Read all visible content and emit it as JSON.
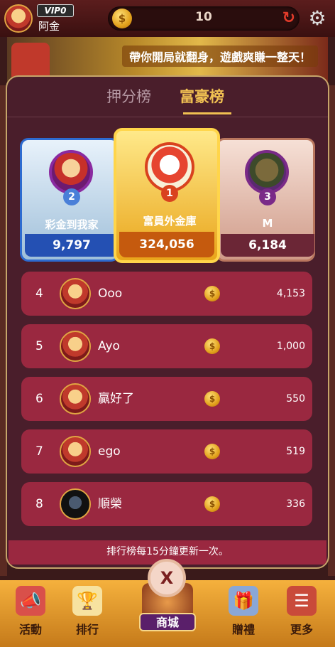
{
  "header": {
    "vip_label": "VIP0",
    "username": "阿金",
    "balance": "10",
    "coin_glyph": "$",
    "refresh_icon": "refresh-icon",
    "settings_icon": "gear-icon"
  },
  "banner": {
    "text": "帶你開局就翻身，遊戲爽賺一整天！"
  },
  "tabs": [
    {
      "label": "押分榜",
      "active": false
    },
    {
      "label": "富豪榜",
      "active": true
    }
  ],
  "podium": [
    {
      "rank": "2",
      "name": "彩金到我家",
      "value": "9,797"
    },
    {
      "rank": "1",
      "name": "富員外金庫",
      "value": "324,056"
    },
    {
      "rank": "3",
      "name": "M",
      "value": "6,184"
    }
  ],
  "rows": [
    {
      "rank": "4",
      "name": "Ooo",
      "score": "4,153"
    },
    {
      "rank": "5",
      "name": "Ayo",
      "score": "1,000"
    },
    {
      "rank": "6",
      "name": "贏好了",
      "score": "550"
    },
    {
      "rank": "7",
      "name": "ego",
      "score": "519"
    },
    {
      "rank": "8",
      "name": "順榮",
      "score": "336"
    }
  ],
  "footer_note": "排行榜每15分鐘更新一次。",
  "close_label": "X",
  "nav": {
    "activity": "活動",
    "ranking": "排行",
    "shop": "商城",
    "gift": "贈禮",
    "more": "更多"
  },
  "colors": {
    "panel": "#4a1e2b",
    "row": "#9a2840",
    "accent": "#f0c052",
    "rank2": "#2450b3",
    "rank1": "#c55a0e",
    "rank3": "#6b2636"
  }
}
